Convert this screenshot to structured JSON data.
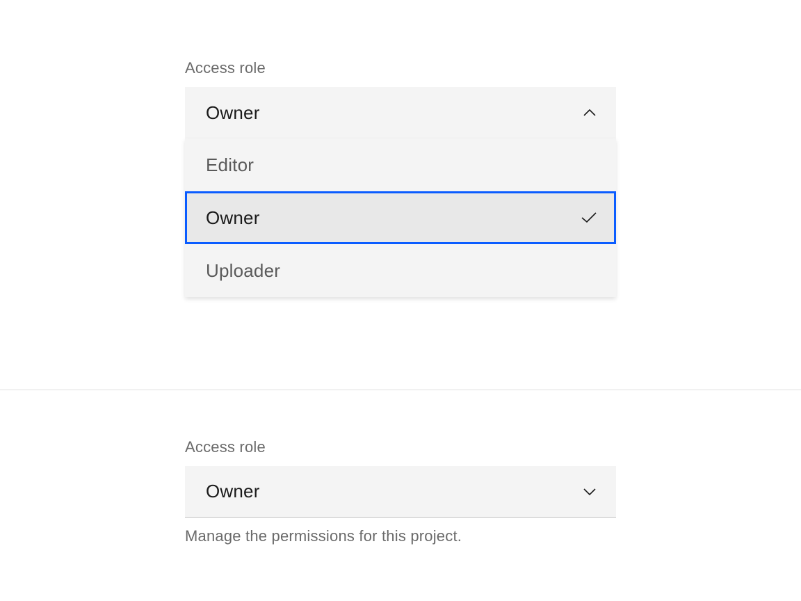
{
  "dropdown1": {
    "label": "Access role",
    "selected_value": "Owner",
    "options": [
      {
        "label": "Editor",
        "selected": false
      },
      {
        "label": "Owner",
        "selected": true
      },
      {
        "label": "Uploader",
        "selected": false
      }
    ]
  },
  "dropdown2": {
    "label": "Access role",
    "selected_value": "Owner",
    "helper": "Manage the permissions for this project."
  }
}
